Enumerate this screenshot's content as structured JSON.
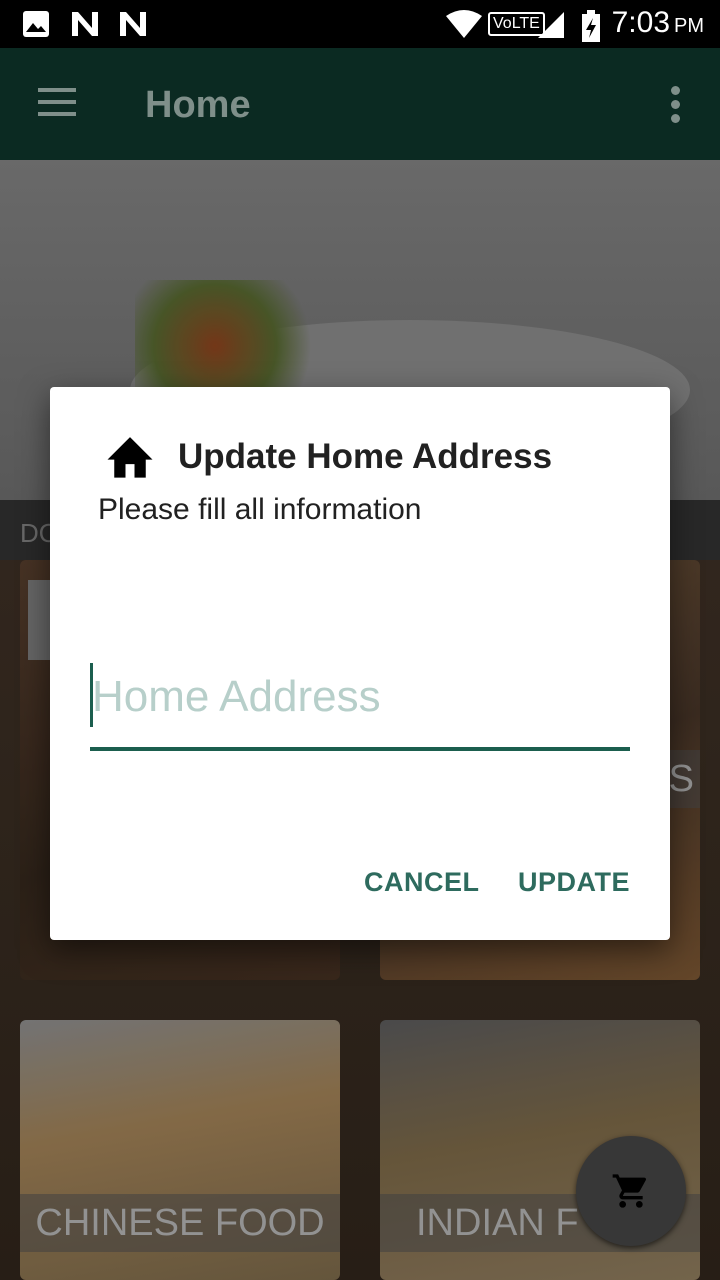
{
  "status_bar": {
    "time": "7:03",
    "ampm": "PM",
    "network_badge": "VoLTE",
    "icons": [
      "image-icon",
      "n-notification-icon",
      "n-notification-icon",
      "wifi-icon",
      "signal-icon",
      "battery-charging-icon"
    ]
  },
  "app_bar": {
    "title": "Home",
    "icons": [
      "menu-icon",
      "more-vert-icon"
    ]
  },
  "background": {
    "section_label": "DO",
    "cards": [
      {
        "label": ""
      },
      {
        "label": "PS"
      },
      {
        "label": "CHINESE FOOD"
      },
      {
        "label": "INDIAN F"
      }
    ]
  },
  "fab": {
    "icon": "shopping-cart-icon"
  },
  "dialog": {
    "icon": "home-icon",
    "title": "Update Home Address",
    "message": "Please fill all information",
    "input": {
      "value": "",
      "placeholder": "Home Address"
    },
    "cancel_label": "CANCEL",
    "update_label": "UPDATE"
  },
  "colors": {
    "app_bar": "#0b2a22",
    "accent": "#2e6b5e",
    "input_underline": "#1b5e4e",
    "placeholder": "#b7cfca"
  }
}
